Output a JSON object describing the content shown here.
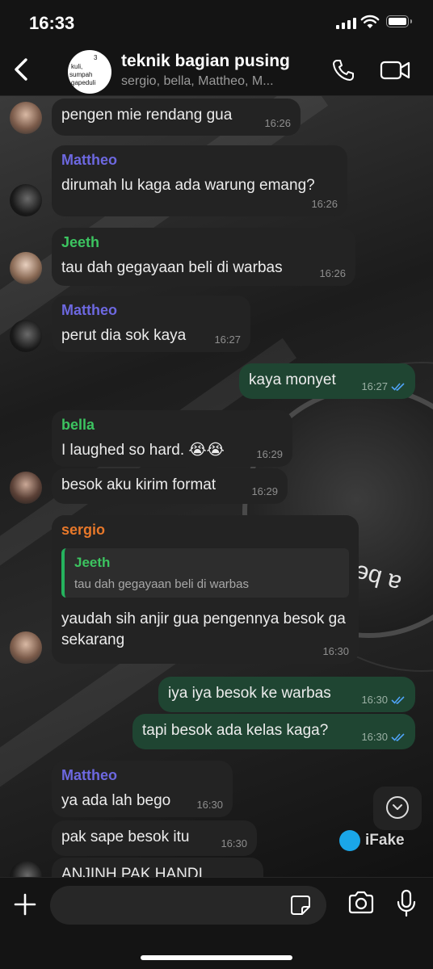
{
  "status_bar": {
    "time": "16:33"
  },
  "header": {
    "title": "teknik bagian pusing",
    "subtitle": "sergio, bella, Mattheo, M...",
    "avatar_text": [
      "3",
      "kuli,",
      "sumpah",
      "gapeduli"
    ]
  },
  "colors": {
    "mattheo": "#6d68e0",
    "jeeth": "#3cc460",
    "bella": "#3cc460",
    "sergio": "#e8782a",
    "outgoing_bubble": "#1f4532",
    "incoming_bubble": "#232323",
    "read_ticks": "#4fa3f7"
  },
  "messages": [
    {
      "sender": "",
      "text": "pengen mie rendang gua",
      "time": "16:26",
      "dir": "in"
    },
    {
      "sender": "Mattheo",
      "text": "dirumah lu kaga ada warung emang?",
      "time": "16:26",
      "dir": "in"
    },
    {
      "sender": "Jeeth",
      "text": "tau dah gegayaan beli di warbas",
      "time": "16:26",
      "dir": "in"
    },
    {
      "sender": "Mattheo",
      "text": "perut dia sok kaya",
      "time": "16:27",
      "dir": "in"
    },
    {
      "sender": "",
      "text": "kaya monyet",
      "time": "16:27",
      "dir": "out"
    },
    {
      "sender": "bella",
      "text": "I laughed so hard. 😭😭",
      "time": "16:29",
      "dir": "in"
    },
    {
      "sender": "",
      "text": "besok aku kirim format",
      "time": "16:29",
      "dir": "in"
    },
    {
      "sender": "sergio",
      "text": "yaudah sih anjir gua pengennya besok ga sekarang",
      "time": "16:30",
      "dir": "in",
      "quote": {
        "name": "Jeeth",
        "text": "tau dah gegayaan beli di warbas"
      }
    },
    {
      "sender": "",
      "text": "iya iya besok ke warbas",
      "time": "16:30",
      "dir": "out"
    },
    {
      "sender": "",
      "text": "tapi besok ada kelas kaga?",
      "time": "16:30",
      "dir": "out"
    },
    {
      "sender": "Mattheo",
      "text": "ya ada lah bego",
      "time": "16:30",
      "dir": "in"
    },
    {
      "sender": "",
      "text": "pak sape besok itu",
      "time": "16:30",
      "dir": "in"
    },
    {
      "sender": "",
      "text": "ANJINH PAK HANDI",
      "time": "",
      "dir": "in"
    }
  ],
  "wallpaper": {
    "drum_text": "a beautiful"
  },
  "watermark": "iFake",
  "composer": {
    "placeholder": ""
  },
  "icons": {
    "back": "chevron-left-icon",
    "call": "phone-icon",
    "video": "video-camera-icon",
    "plus": "plus-icon",
    "sticker": "sticker-icon",
    "camera": "camera-icon",
    "mic": "microphone-icon",
    "scroll": "chevron-down-icon"
  }
}
